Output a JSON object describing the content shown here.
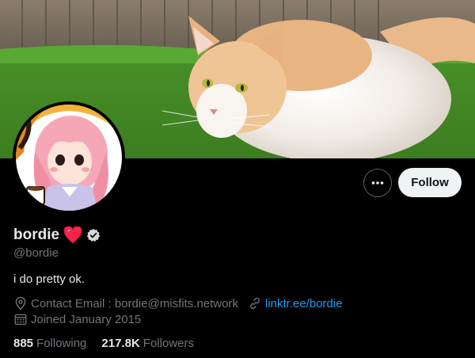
{
  "banner": {
    "image": "orange-and-white-cat-on-grass"
  },
  "avatar": {
    "image": "cartoon-pink-hair-girl-with-coffee"
  },
  "actions": {
    "more_icon": "more-horizontal-icon",
    "follow_label": "Follow"
  },
  "profile": {
    "display_name": "bordie",
    "emoji": "red-heart",
    "verified_icon": "verified-badge-icon",
    "handle": "@bordie",
    "bio": "i do pretty ok.",
    "location": "Contact Email : bordie@misfits.network",
    "website": "linktr.ee/bordie",
    "joined": "Joined January 2015"
  },
  "stats": {
    "following_count": "885",
    "following_label": "Following",
    "followers_count": "217.8K",
    "followers_label": "Followers"
  },
  "colors": {
    "background": "#000000",
    "link": "#1d9bf0",
    "muted": "#71767b",
    "text": "#e7e9ea",
    "button": "#eff3f4"
  }
}
